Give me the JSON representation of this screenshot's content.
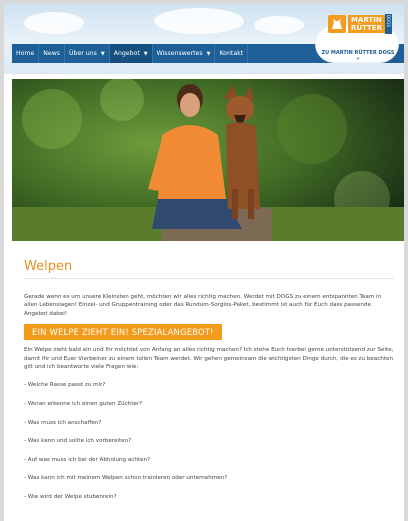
{
  "nav": {
    "items": [
      {
        "label": "Home",
        "dropdown": false,
        "active": false
      },
      {
        "label": "News",
        "dropdown": false,
        "active": false
      },
      {
        "label": "Über uns",
        "dropdown": true,
        "active": false
      },
      {
        "label": "Angebot",
        "dropdown": true,
        "active": true
      },
      {
        "label": "Wissenswertes",
        "dropdown": true,
        "active": false
      },
      {
        "label": "Kontakt",
        "dropdown": false,
        "active": false
      }
    ]
  },
  "logo": {
    "line1": "MARTIN",
    "line2": "RÜTTER",
    "side": "DOGS",
    "link": "ZU MARTIN RÜTTER DOGS »"
  },
  "colors": {
    "accent": "#f49b1b",
    "nav": "#1f5f97",
    "heading": "#e8901f"
  },
  "main": {
    "title": "Welpen",
    "intro": "Gerade wenn es um unsere Kleinsten geht, möchten wir alles richtig machen. Werdet mit DOGS zu einem entspannten Team in allen Lebenslagen! Einzel- und Gruppentraining oder das Rundum-Sorglos-Paket, bestimmt ist auch für Euch dass passende Angebot dabei!",
    "promo": "EIN WELPE ZIEHT EIN! SPEZIALANGEBOT!",
    "body": "Ein Welpe zieht bald ein und Ihr möchtet von Anfang an alles richtig machen? Ich stehe Euch hierbei gerne unterstützend zur Seite, damit Ihr und Euer Vierbeiner zu einem tollen Team werdet. Wir gehen gemeinsam die wichtigsten Dinge durch, die es zu beachten gilt und ich beantworte viele Fragen wie:",
    "questions": [
      "- Welche Rasse passt zu mir?",
      "- Woran erkenne ich einen guten Züchter?",
      "- Was muss ich anschaffen?",
      "- Was kann und sollte ich vorbereiten?",
      "- Auf was muss ich bei der Abholung achten?",
      "- Was kann ich mit meinem Welpen schon trainieren oder unternehmen?",
      "- Wie wird der Welpe stubenrein?"
    ]
  }
}
